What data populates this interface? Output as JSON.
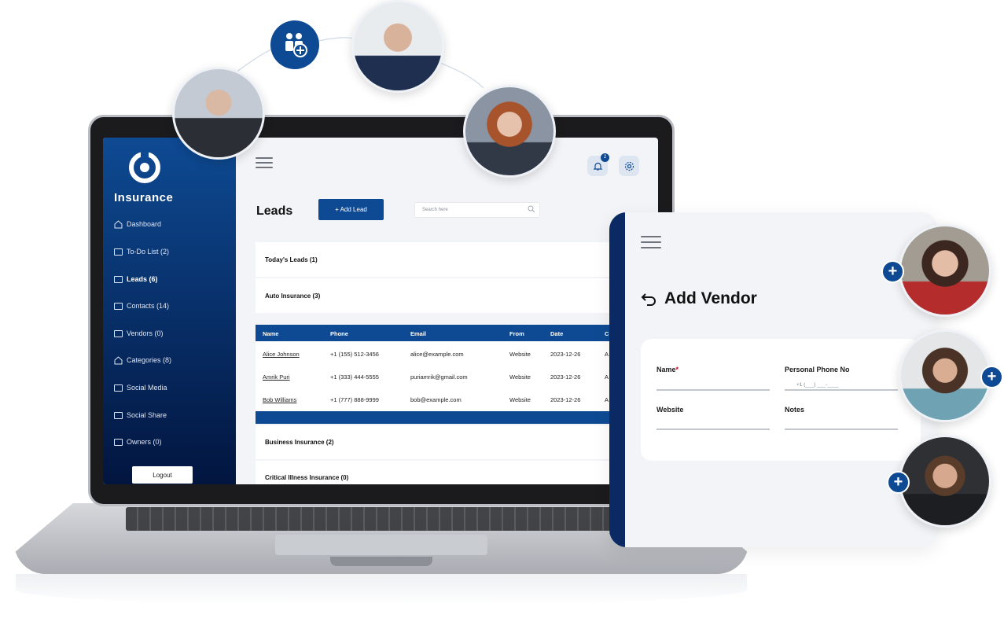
{
  "brand": {
    "name": "Insurance"
  },
  "sidebar": {
    "items": [
      {
        "label": "Dashboard"
      },
      {
        "label": "To-Do List (2)"
      },
      {
        "label": "Leads (6)"
      },
      {
        "label": "Contacts (14)"
      },
      {
        "label": "Vendors (0)"
      },
      {
        "label": "Categories (8)"
      },
      {
        "label": "Social Media"
      },
      {
        "label": "Social Share"
      },
      {
        "label": "Owners (0)"
      }
    ],
    "logout_label": "Logout"
  },
  "header": {
    "notification_count": "2"
  },
  "leads": {
    "title": "Leads",
    "add_lead_label": "+ Add Lead",
    "search_placeholder": "Search here",
    "groups": [
      {
        "label": "Today's Leads (1)"
      },
      {
        "label": "Auto Insurance (3)"
      },
      {
        "label": "Business Insurance (2)"
      },
      {
        "label": "Critical Illness Insurance (0)"
      }
    ],
    "table": {
      "columns": [
        "Name",
        "Phone",
        "Email",
        "From",
        "Date",
        "C"
      ],
      "rows": [
        {
          "name": "Alice Johnson",
          "phone": "+1 (155) 512-3456",
          "email": "alice@example.com",
          "from": "Website",
          "date": "2023-12-26",
          "c": "A"
        },
        {
          "name": "Amrik Puri",
          "phone": "+1 (333) 444-5555",
          "email": "puriamrik@gmail.com",
          "from": "Website",
          "date": "2023-12-26",
          "c": "A"
        },
        {
          "name": "Bob Williams",
          "phone": "+1 (777) 888-9999",
          "email": "bob@example.com",
          "from": "Website",
          "date": "2023-12-26",
          "c": "A"
        }
      ]
    }
  },
  "vendor_form": {
    "title": "Add Vendor",
    "fields": {
      "name_label": "Name",
      "required_mark": "*",
      "phone_label": "Personal Phone No",
      "phone_placeholder": "+1 (___) ___-____",
      "website_label": "Website",
      "notes_label": "Notes"
    }
  },
  "colors": {
    "primary": "#0e4a93",
    "sidebar_dark": "#02153f",
    "background": "#f3f4f7"
  }
}
